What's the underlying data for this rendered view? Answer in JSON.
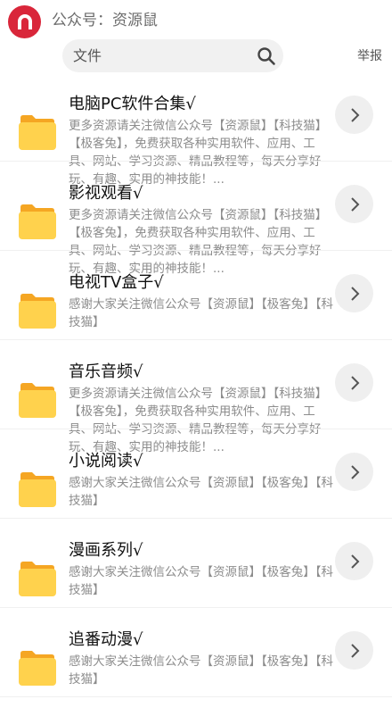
{
  "header": {
    "title": "公众号：资源鼠"
  },
  "search": {
    "placeholder": "文件"
  },
  "report_label": "举报",
  "items": [
    {
      "title": "电脑PC软件合集√",
      "desc": "更多资源请关注微信公众号【资源鼠】【科技猫】【极客兔】，免费获取各种实用软件、应用、工具、网站、学习资源、精品教程等，每天分享好玩、有趣、实用的神技能！..."
    },
    {
      "title": "影视观看√",
      "desc": "更多资源请关注微信公众号【资源鼠】【科技猫】【极客兔】，免费获取各种实用软件、应用、工具、网站、学习资源、精品教程等，每天分享好玩、有趣、实用的神技能！..."
    },
    {
      "title": "电视TV盒子√",
      "desc": "感谢大家关注微信公众号【资源鼠】【极客兔】【科技猫】"
    },
    {
      "title": "音乐音频√",
      "desc": "更多资源请关注微信公众号【资源鼠】【科技猫】【极客兔】，免费获取各种实用软件、应用、工具、网站、学习资源、精品教程等，每天分享好玩、有趣、实用的神技能！..."
    },
    {
      "title": "小说阅读√",
      "desc": "感谢大家关注微信公众号【资源鼠】【极客兔】【科技猫】"
    },
    {
      "title": "漫画系列√",
      "desc": "感谢大家关注微信公众号【资源鼠】【极客兔】【科技猫】"
    },
    {
      "title": "追番动漫√",
      "desc": "感谢大家关注微信公众号【资源鼠】【极客兔】【科技猫】"
    }
  ],
  "icons": {
    "avatar": "magnet-icon",
    "search": "search-icon",
    "folder": "folder-icon",
    "chevron": "chevron-right-icon"
  },
  "colors": {
    "avatar_bg": "#d9263a",
    "folder": "#ffd24d",
    "folder_tab": "#f5a623"
  }
}
